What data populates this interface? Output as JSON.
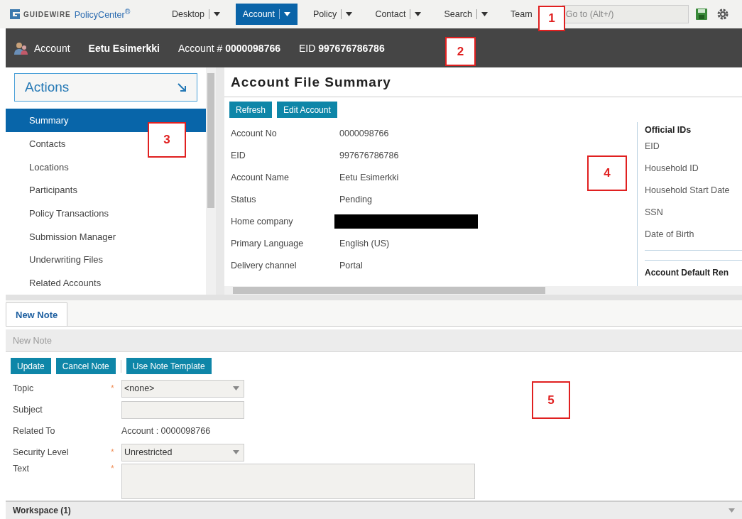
{
  "app": {
    "brand": "GUIDEWIRE",
    "product": "PolicyCenter",
    "trademark": "®"
  },
  "nav": [
    {
      "label": "Desktop",
      "selected": false,
      "menu": true
    },
    {
      "label": "Account",
      "selected": true,
      "menu": true
    },
    {
      "label": "Policy",
      "selected": false,
      "menu": true
    },
    {
      "label": "Contact",
      "selected": false,
      "menu": true
    },
    {
      "label": "Search",
      "selected": false,
      "menu": true
    },
    {
      "label": "Team",
      "selected": false,
      "menu": false
    }
  ],
  "goto": {
    "placeholder": "Go to (Alt+/)"
  },
  "header": {
    "label": "Account",
    "name": "Eetu Esimerkki",
    "account_label": "Account #",
    "account_no": "0000098766",
    "eid_label": "EID",
    "eid": "997676786786"
  },
  "actions": {
    "label": "Actions"
  },
  "sidebar": {
    "items": [
      {
        "label": "Summary",
        "selected": true
      },
      {
        "label": "Contacts",
        "selected": false
      },
      {
        "label": "Locations",
        "selected": false
      },
      {
        "label": "Participants",
        "selected": false
      },
      {
        "label": "Policy Transactions",
        "selected": false
      },
      {
        "label": "Submission Manager",
        "selected": false
      },
      {
        "label": "Underwriting Files",
        "selected": false
      },
      {
        "label": "Related Accounts",
        "selected": false
      }
    ]
  },
  "summary": {
    "title": "Account File Summary",
    "buttons": [
      "Refresh",
      "Edit Account"
    ],
    "fields": [
      {
        "label": "Account No",
        "value": "0000098766"
      },
      {
        "label": "EID",
        "value": "997676786786"
      },
      {
        "label": "Account Name",
        "value": "Eetu Esimerkki"
      },
      {
        "label": "Status",
        "value": "Pending"
      },
      {
        "label": "Home company",
        "redacted": true
      },
      {
        "label": "Primary Language",
        "value": "English (US)"
      },
      {
        "label": "Delivery channel",
        "value": "Portal"
      }
    ],
    "side_title": "Official IDs",
    "side_fields": [
      "EID",
      "Household ID",
      "Household Start Date",
      "SSN",
      "Date of Birth"
    ],
    "side_title_2": "Account Default Ren"
  },
  "tabs": [
    {
      "label": "New Note",
      "selected": true
    }
  ],
  "note": {
    "title": "New Note",
    "buttons": [
      "Update",
      "Cancel Note",
      "Use Note Template"
    ],
    "fields": [
      {
        "label": "Topic",
        "kind": "select",
        "required_mark": "*",
        "value": "<none>"
      },
      {
        "label": "Subject",
        "kind": "input"
      },
      {
        "label": "Related To",
        "kind": "text",
        "value": "Account : 0000098766"
      },
      {
        "label": "Security Level",
        "kind": "select",
        "required_mark": "*",
        "value": "Unrestricted"
      },
      {
        "label": "Text",
        "kind": "textarea",
        "required_mark": "*"
      }
    ]
  },
  "workspace": {
    "label": "Workspace (1)"
  },
  "annotations": [
    "1",
    "2",
    "3",
    "4",
    "5"
  ]
}
